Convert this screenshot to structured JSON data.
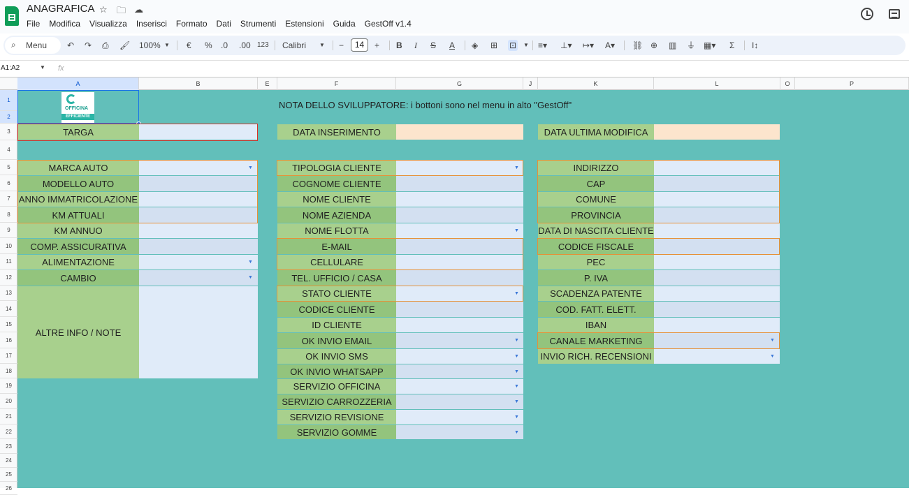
{
  "app": {
    "title": "ANAGRAFICA",
    "menus": [
      "File",
      "Modifica",
      "Visualizza",
      "Inserisci",
      "Formato",
      "Dati",
      "Strumenti",
      "Estensioni",
      "Guida",
      "GestOff v1.4"
    ]
  },
  "toolbar": {
    "search": "Menu",
    "zoom": "100%",
    "currency": "€",
    "percent": "%",
    "dec_less": ".0",
    "dec_more": ".00",
    "number_format": "123",
    "font": "Calibri",
    "font_size": "14",
    "minus": "−",
    "plus": "+",
    "bold": "B",
    "italic": "I",
    "sum": "Σ"
  },
  "formula_bar": {
    "name_box": "A1:A2",
    "fx": "fx"
  },
  "columns": [
    "A",
    "B",
    "E",
    "F",
    "G",
    "J",
    "K",
    "L",
    "O",
    "P"
  ],
  "rows": [
    "1",
    "2",
    "3",
    "4",
    "5",
    "6",
    "7",
    "8",
    "9",
    "10",
    "11",
    "12",
    "13",
    "14",
    "15",
    "16",
    "17",
    "18",
    "19",
    "20",
    "21",
    "22",
    "23",
    "24",
    "25",
    "26"
  ],
  "sheet": {
    "note": "NOTA DELLO SVILUPPATORE: i bottoni sono nel menu in alto \"GestOff\"",
    "logo": {
      "line1": "OFFICINA",
      "line2": "EFFICIENTE"
    },
    "targa": "TARGA",
    "data_inserimento": "DATA INSERIMENTO",
    "data_ultima_modifica": "DATA ULTIMA MODIFICA",
    "left": [
      "MARCA AUTO",
      "MODELLO AUTO",
      "ANNO IMMATRICOLAZIONE",
      "KM ATTUALI",
      "KM ANNUO",
      "COMP. ASSICURATIVA",
      "ALIMENTAZIONE",
      "CAMBIO"
    ],
    "altre_info": "ALTRE INFO / NOTE",
    "middle": [
      "TIPOLOGIA CLIENTE",
      "COGNOME CLIENTE",
      "NOME CLIENTE",
      "NOME AZIENDA",
      "NOME FLOTTA",
      "E-MAIL",
      "CELLULARE",
      "TEL. UFFICIO / CASA",
      "STATO CLIENTE",
      "CODICE CLIENTE",
      "ID CLIENTE",
      "OK INVIO EMAIL",
      "OK INVIO SMS",
      "OK INVIO WHATSAPP",
      "SERVIZIO OFFICINA",
      "SERVIZIO CARROZZERIA",
      "SERVIZIO REVISIONE",
      "SERVIZIO GOMME"
    ],
    "right": [
      "INDIRIZZO",
      "CAP",
      "COMUNE",
      "PROVINCIA",
      "DATA DI NASCITA CLIENTE",
      "CODICE FISCALE",
      "PEC",
      "P. IVA",
      "SCADENZA PATENTE",
      "COD. FATT. ELETT.",
      "IBAN",
      "CANALE MARKETING",
      "INVIO RICH. RECENSIONI"
    ]
  },
  "colors": {
    "grid_bg": "#62bfba",
    "label": "#a8d08d",
    "value": "#e0ebf9",
    "peach": "#fce5cd",
    "orange": "#e69138",
    "red": "#d93025"
  }
}
